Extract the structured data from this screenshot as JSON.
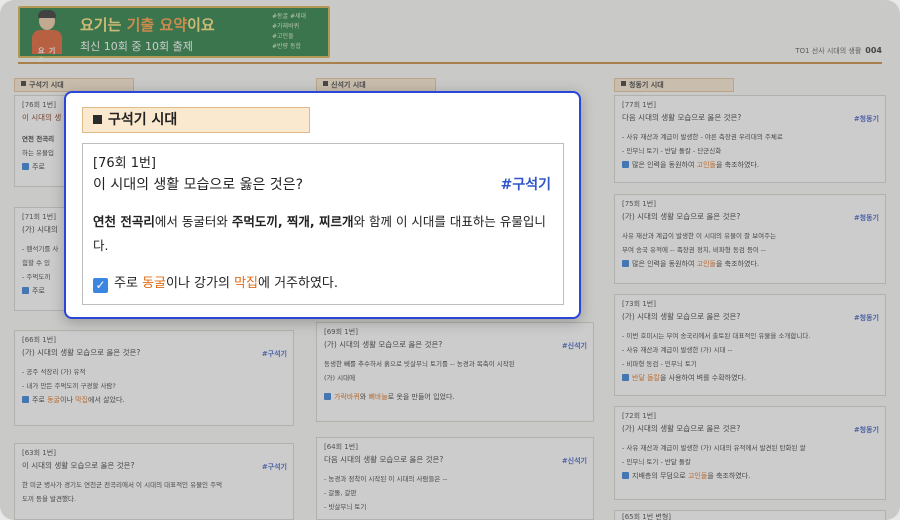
{
  "banner": {
    "avatar_tag": "요 기 요",
    "title_pre": "요기는 ",
    "title_hl": "기출 요약",
    "title_post": "이요",
    "subtitle": "최신 10회 중 10회 출제",
    "tags": "#동굴  #세대\n#가래바퀴\n#고인돌\n#반량 동합"
  },
  "page_meta": {
    "label": "TO1 선사 시대의 생활",
    "page": "004"
  },
  "paleolithic": {
    "section": "구석기 시대",
    "cards": [
      {
        "num": "[76회 1번]",
        "q": "이 시대의 생",
        "l1": "연천 전곡리",
        "l2": "하는 유물입",
        "ans": "주로"
      },
      {
        "num": "[71회 1번]",
        "q": "(가) 시대의",
        "l1": "- 뗀석기를 사",
        "l2": "힘할 수 있",
        "l3": "- 주먹도끼",
        "ans": "주로"
      },
      {
        "num": "[66회 1번]",
        "q": "(가) 시대의 생활 모습으로 옳은 것은?",
        "tag": "#구석기",
        "l1": "- 공주 석장리 (가) 유적",
        "l2": "- 내가 만든 주먹도끼 구경할 사람?",
        "ans_pre": "주로 ",
        "ans_hl1": "동굴",
        "ans_mid": "이나 ",
        "ans_hl2": "막집",
        "ans_post": "에서 살았다."
      },
      {
        "num": "[63회 1번]",
        "q": "이 시대의 생활 모습으로 옳은 것은?",
        "tag": "#구석기",
        "l1": "한 미군 병사가 경기도 연천군 전곡리에서 이 시대의 대표적인 유물인 주먹",
        "l2": "도끼 등을 발견했다."
      }
    ]
  },
  "neolithic": {
    "section": "신석기 시대",
    "cards": [
      {
        "num": "[69회 1번]",
        "q": "(가) 시대의 생활 모습으로 옳은 것은?",
        "tag": "#신석기",
        "l1": "동생한 빼를 추수하서 흙으로 빗살무늬 토기를 -- 농경과 목축이 시작된",
        "l2": "(가) 시대에",
        "ans_hl1": "가락바퀴",
        "ans_mid": "와 ",
        "ans_hl2": "뼈바늘",
        "ans_post": "로 옷을 만들어 입었다."
      },
      {
        "num": "[64회 1번]",
        "q": "다음 시대의 생활 모습으로 옳은 것은?",
        "tag": "#신석기",
        "l1": "- 농경과 정착이 시작된 이 시대의 사람들은 --",
        "l2": "- 갈돌, 갈판",
        "l3": "- 빗살무늬 토기"
      }
    ]
  },
  "bronze": {
    "section": "청동기 시대",
    "cards": [
      {
        "num": "[77회 1번]",
        "q": "다음 시대의 생활 모습으로 옳은 것은?",
        "tag": "#청동기",
        "l1": "- 사유 재산과 계급이 발생한   - 야른 측장권 우리대의 주체로",
        "l2": "- 민무늬 토기    - 반달 돌칼    - 단군신화",
        "ans_pre": "많은 인력을 동원하여 ",
        "ans_hl1": "고인돌",
        "ans_post": "을 축조하였다."
      },
      {
        "num": "[75회 1번]",
        "q": "(가) 시대의 생활 모습으로 옳은 것은?",
        "tag": "#청동기",
        "l1": "사유 재산과 계급이 발생한 이 시대의 유물이 잘 보여주는",
        "l2": "부여 송국 유적에 -- 족장권 정치, 비파형 동검 등이 --",
        "ans_pre": "많은 인력을 동원하여 ",
        "ans_hl1": "고인돌",
        "ans_post": "을 축조하였다."
      },
      {
        "num": "[73회 1번]",
        "q": "(가) 시대의 생활 모습으로 옳은 것은?",
        "tag": "#청동기",
        "l1": "- 이번 호미시는 부여 송국리에서 출토된 대표적인 유물을 소개합니다.",
        "l2": "- 사유 재산과 계급이 발생한 (가) 시대 --",
        "l3": "- 비파형 동검         - 민무늬 토기",
        "ans_hl1": "반달 돌칼",
        "ans_post": "을 사용하여 벼를 수확하였다."
      },
      {
        "num": "[72회 1번]",
        "q": "(가) 시대의 생활 모습으로 옳은 것은?",
        "tag": "#청동기",
        "l1": "- 사유 재산과 계급이 발생한 (가) 시대의 유적에서 발견된 탄화된 쌀",
        "l2": "- 민무늬 토기          - 반달 돌칼",
        "ans_pre": "지배층의 무덤으로 ",
        "ans_hl1": "고인돌",
        "ans_post": "을 축조하였다."
      },
      {
        "num": "[65회 1번 변형]"
      }
    ]
  },
  "popup": {
    "section": "구석기 시대",
    "num": "[76회 1번]",
    "question": "이 시대의 생활 모습으로 옳은 것은?",
    "tag": "#구석기",
    "desc_b1": "연천 전곡리",
    "desc_t1": "에서 동굴터와 ",
    "desc_b2": "주먹도끼, 찍개, 찌르개",
    "desc_t2": "와 함께 이 시대를 대표하는 유물입니다.",
    "ans_pre": "주로 ",
    "ans_hl1": "동굴",
    "ans_mid": "이나 강가의 ",
    "ans_hl2": "막집",
    "ans_post": "에 거주하였다.",
    "check_glyph": "✓",
    "colors": {
      "border": "#2a46d8",
      "highlight": "#e06c15",
      "tag": "#2f55c8"
    }
  }
}
